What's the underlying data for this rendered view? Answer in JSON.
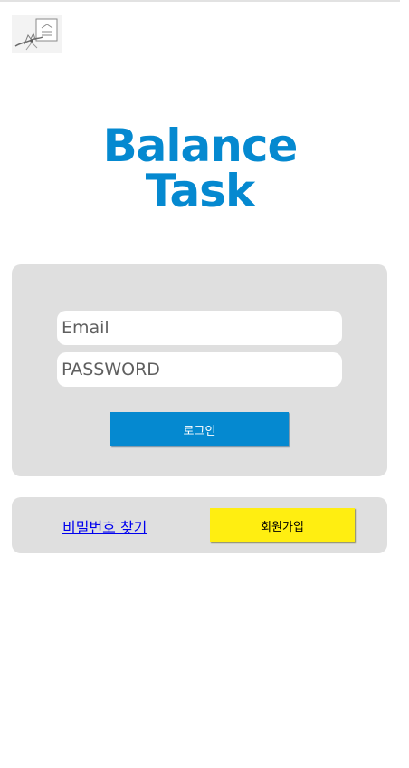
{
  "app": {
    "title_line1": "Balance",
    "title_line2": "Task",
    "brand_color": "#0589d0"
  },
  "logo": {
    "icon": "document-sketch-logo"
  },
  "login_form": {
    "email_placeholder": "Email",
    "password_placeholder": "PASSWORD",
    "login_label": "로그인"
  },
  "footer_actions": {
    "find_password_label": "비밀번호 찾기",
    "signup_label": "회원가입",
    "signup_color": "#ffee11"
  }
}
